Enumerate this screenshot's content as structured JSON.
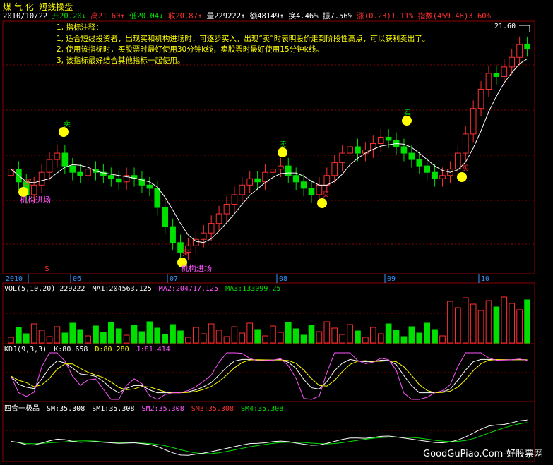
{
  "app": {
    "stock_name": "煤 气 化",
    "indicator_name": "短线操盘"
  },
  "info_bar": {
    "date": "2010/10/22",
    "open_label": "开",
    "open": "20.20",
    "high_label": "高",
    "high": "21.60",
    "low_label": "低",
    "low": "20.04",
    "close_label": "收",
    "close": "20.87",
    "volume_label": "量",
    "volume": "229222",
    "amount_label": "额",
    "amount": "48149",
    "turnover_label": "换",
    "turnover": "4.46%",
    "amplitude_label": "振",
    "amplitude": "7.56%",
    "change_label": "涨",
    "change": "(0.23)",
    "change_pct": "1.11%",
    "index_label": "指数",
    "index_value": "(459.48)",
    "index_pct": "3.60%"
  },
  "notes": [
    "1, 指标注释：",
    "1, 适合短线投资者，出现买和机构进场时，可逐步买入，出现“卖”时表明股价走到阶段性高点，可以获利卖出了。",
    "2, 使用该指标时，买股票时最好使用30分钟k线，卖股票时最好使用15分钟k线。",
    "3, 该指标最好结合其他指标一起使用。"
  ],
  "price_panel": {
    "high_marker": "21.60",
    "signal_buy": "买",
    "signal_sell": "卖",
    "institution_label_1": "机构进场",
    "institution_label_2": "机构进场",
    "dollar_marker": "$"
  },
  "time_axis": {
    "labels": [
      "2010",
      "06",
      "07",
      "08",
      "09",
      "10"
    ]
  },
  "vol_panel": {
    "name": "VOL(5,10,20)",
    "value": "229222",
    "ma1_label": "MA1:",
    "ma1": "204563.125",
    "ma2_label": "MA2:",
    "ma2": "204717.125",
    "ma3_label": "MA3:",
    "ma3": "133099.25"
  },
  "kdj_panel": {
    "name": "KDJ(9,3,3)",
    "k_label": "K:",
    "k": "80.658",
    "d_label": "D:",
    "d": "80.280",
    "j_label": "J:",
    "j": "81.414"
  },
  "sihe_panel": {
    "name": "四合一极品",
    "sm_label": "SM:",
    "sm": "35.308",
    "sm1_label": "SM1:",
    "sm1": "35.308",
    "sm2_label": "SM2:",
    "sm2": "35.308",
    "sm3_label": "SM3:",
    "sm3": "35.308",
    "sm4_label": "SM4:",
    "sm4": "35.308"
  },
  "watermark": "GoodGuPiao.Com-好股票网",
  "colors": {
    "background": "#000000",
    "up": "#ff3030",
    "down": "#00e000",
    "grid": "#8b0000",
    "text_yellow": "#ffff00",
    "text_magenta": "#ff55ff",
    "ma_white": "#ffffff"
  },
  "chart_data": {
    "type": "candlestick",
    "period": "daily",
    "x_range": [
      "2010-05",
      "2010-10-22"
    ],
    "y_range_approx": [
      14.0,
      21.6
    ],
    "last_candle": {
      "open": 20.2,
      "high": 21.6,
      "low": 20.04,
      "close": 20.87,
      "volume": 229222
    },
    "close_trend_approx": [
      17.1,
      16.7,
      16.3,
      16.6,
      17.0,
      17.4,
      17.6,
      17.2,
      17.0,
      16.9,
      17.1,
      17.0,
      16.9,
      16.8,
      16.7,
      16.9,
      16.8,
      16.6,
      16.5,
      15.9,
      15.3,
      14.8,
      14.5,
      14.7,
      14.9,
      15.1,
      15.4,
      15.7,
      16.0,
      16.3,
      16.6,
      16.8,
      16.7,
      17.0,
      17.1,
      17.2,
      16.9,
      16.7,
      16.5,
      16.3,
      16.6,
      16.9,
      17.3,
      17.6,
      17.8,
      17.6,
      17.7,
      17.9,
      18.1,
      18.0,
      17.8,
      17.6,
      17.4,
      17.2,
      17.0,
      16.8,
      16.9,
      17.1,
      17.6,
      18.2,
      19.0,
      19.6,
      20.1,
      20.0,
      20.3,
      20.6,
      21.0,
      20.87
    ]
  }
}
